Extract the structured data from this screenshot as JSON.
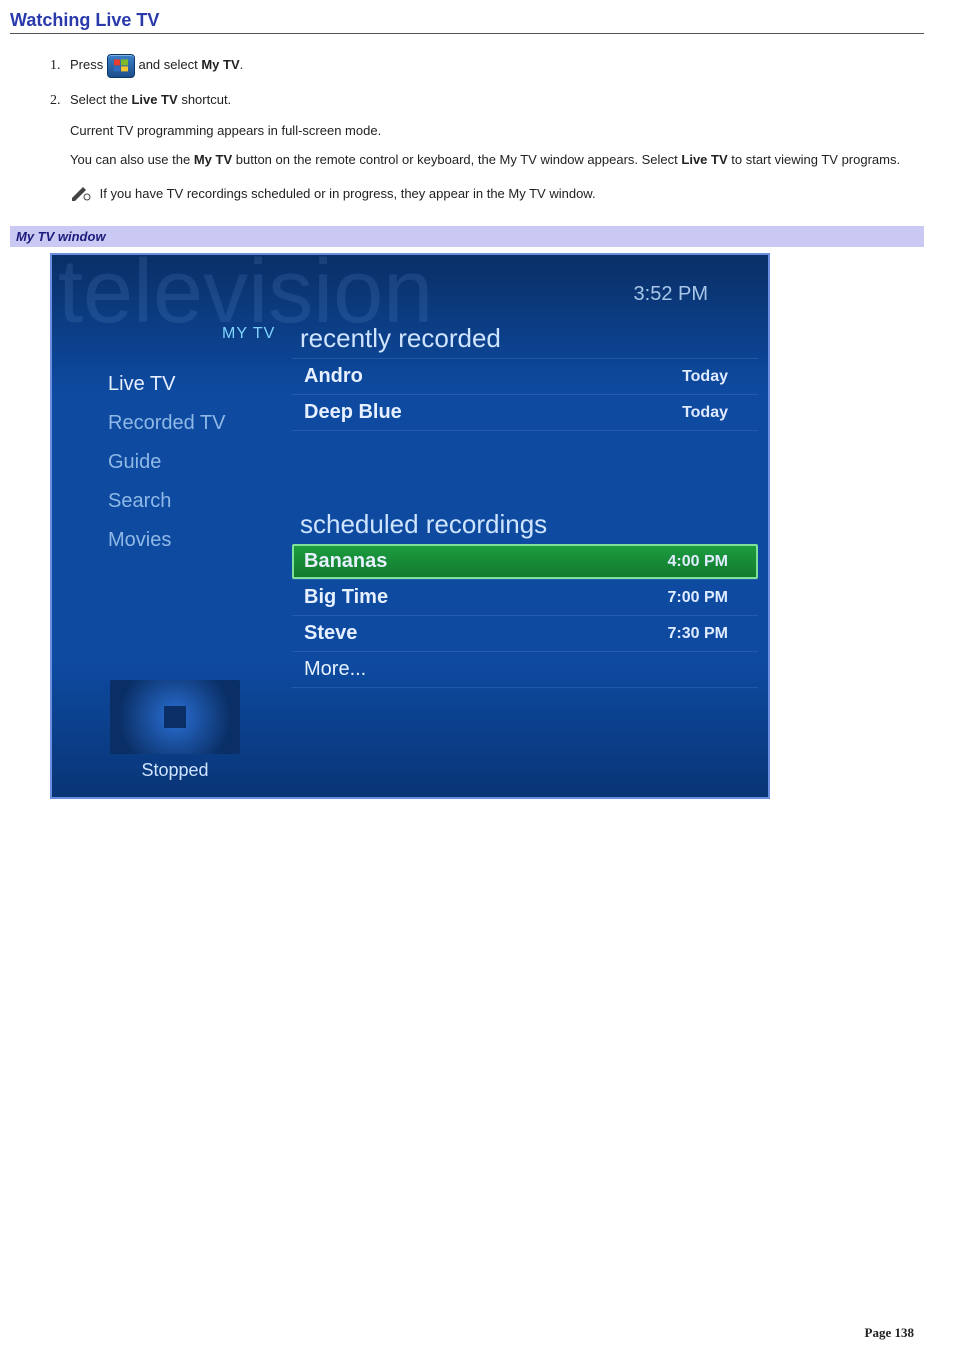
{
  "section_title": "Watching Live TV",
  "steps": {
    "step1_prefix": "Press ",
    "step1_suffix": "and select ",
    "step1_bold": "My TV",
    "step1_end": ".",
    "step2_prefix": "Select the ",
    "step2_bold": "Live TV",
    "step2_suffix": " shortcut.",
    "para_full": "Current TV programming appears in full-screen mode.",
    "para2_a": "You can also use the ",
    "para2_b": "My TV",
    "para2_c": " button on the remote control or keyboard, the My TV window appears. Select ",
    "para2_d": "Live TV",
    "para2_e": " to start viewing TV programs."
  },
  "note_text": " If you have TV recordings scheduled or in progress, they appear in the My TV window.",
  "caption": "My TV window",
  "mc": {
    "watermark": "television",
    "clock": "3:52 PM",
    "header_label": "MY TV",
    "sidebar": [
      "Live TV",
      "Recorded TV",
      "Guide",
      "Search",
      "Movies"
    ],
    "section1_title": "recently recorded",
    "recent": [
      {
        "title": "Andro",
        "time": "Today"
      },
      {
        "title": "Deep Blue",
        "time": "Today"
      }
    ],
    "section2_title": "scheduled recordings",
    "scheduled": [
      {
        "title": "Bananas",
        "time": "4:00 PM",
        "highlight": true
      },
      {
        "title": "Big Time",
        "time": "7:00 PM"
      },
      {
        "title": "Steve",
        "time": "7:30 PM"
      },
      {
        "title": "More...",
        "time": ""
      }
    ],
    "status_label": "Stopped"
  },
  "footer": "Page 138"
}
